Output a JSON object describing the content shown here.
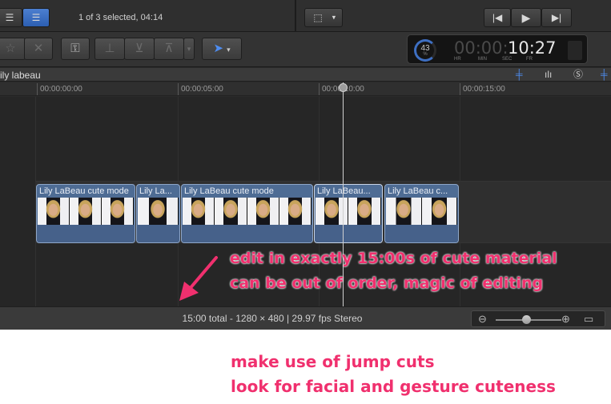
{
  "header": {
    "selection_status": "1 of 3 selected, 04:14"
  },
  "dashboard": {
    "gauge_value": "43",
    "gauge_unit": "%",
    "timecode_dim": "00:00:",
    "timecode_main": "10:27",
    "labels": {
      "hr": "HR",
      "min": "MIN",
      "sec": "SEC",
      "fr": "FR"
    }
  },
  "timeline": {
    "project_name": "ily labeau",
    "ruler": [
      "00:00:00:00",
      "00:00:05:00",
      "00:00:10:00",
      "00:00:15:00"
    ],
    "clips": [
      {
        "name": "Lily LaBeau cute mode"
      },
      {
        "name": "Lily La..."
      },
      {
        "name": "Lily LaBeau cute mode"
      },
      {
        "name": "Lily LaBeau..."
      },
      {
        "name": "Lily LaBeau c..."
      }
    ]
  },
  "statusbar": {
    "summary": "15:00 total - 1280 × 480 | 29.97 fps Stereo"
  },
  "annotations": {
    "overlay_line1": "edit in exactly 15:00s of cute material",
    "overlay_line2": "can be out of order, magic of editing",
    "note_line1": "make use of jump cuts",
    "note_line2": "look for facial and gesture cuteness"
  },
  "colors": {
    "annotation": "#f0306e",
    "clip": "#4e6c94",
    "accent": "#3e7be0"
  },
  "icons": [
    "list-view-icon",
    "clip-view-icon",
    "star-icon",
    "reject-icon",
    "keyword-icon",
    "connect-icon",
    "insert-icon",
    "append-icon",
    "select-arrow-icon",
    "crop-icon",
    "previous-icon",
    "play-icon",
    "next-icon",
    "zoom-out-icon",
    "zoom-in-icon",
    "clip-appearance-icon"
  ]
}
